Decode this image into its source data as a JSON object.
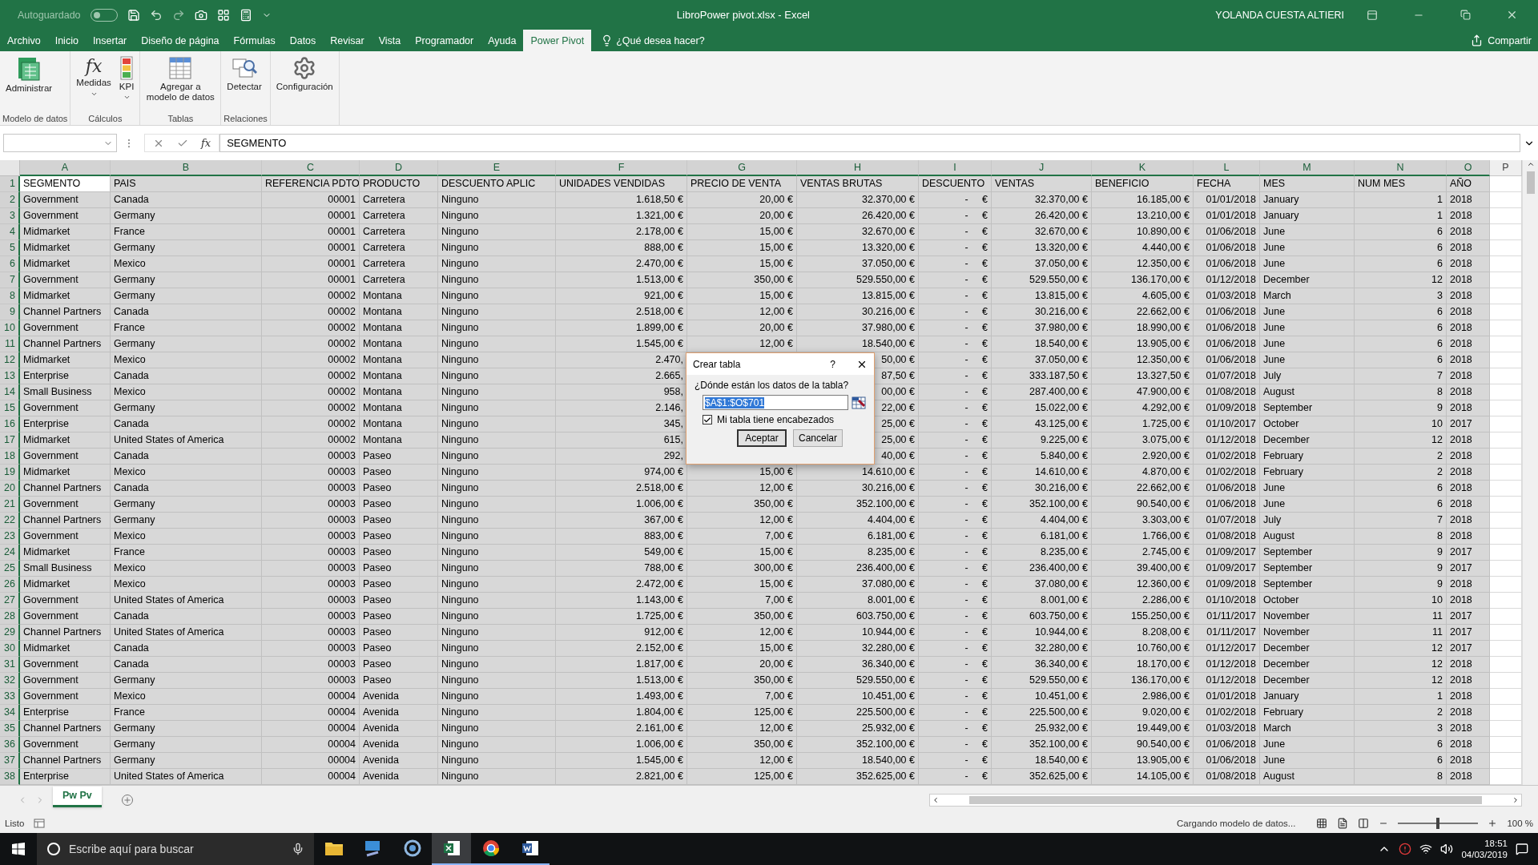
{
  "title_bar": {
    "autosave_label": "Autoguardado",
    "autosave_on": false,
    "title": "LibroPower pivot.xlsx  -  Excel",
    "user": "YOLANDA CUESTA ALTIERI"
  },
  "menu_tabs": [
    {
      "label": "Archivo",
      "selected": false
    },
    {
      "label": "Inicio",
      "selected": false
    },
    {
      "label": "Insertar",
      "selected": false
    },
    {
      "label": "Diseño de página",
      "selected": false
    },
    {
      "label": "Fórmulas",
      "selected": false
    },
    {
      "label": "Datos",
      "selected": false
    },
    {
      "label": "Revisar",
      "selected": false
    },
    {
      "label": "Vista",
      "selected": false
    },
    {
      "label": "Programador",
      "selected": false
    },
    {
      "label": "Ayuda",
      "selected": false
    },
    {
      "label": "Power Pivot",
      "selected": true
    }
  ],
  "tell_me": "¿Qué desea hacer?",
  "share": "Compartir",
  "ribbon_groups": [
    {
      "label": "Modelo de datos",
      "buttons": [
        {
          "label": "Administrar",
          "kind": "manage"
        }
      ]
    },
    {
      "label": "Cálculos",
      "buttons": [
        {
          "label": "Medidas",
          "kind": "function",
          "glyph": "fx",
          "dropdown": true
        },
        {
          "label": "KPI",
          "kind": "kpi",
          "dropdown": true
        }
      ]
    },
    {
      "label": "Tablas",
      "buttons": [
        {
          "label": "Agregar a modelo de datos",
          "kind": "table"
        }
      ]
    },
    {
      "label": "Relaciones",
      "buttons": [
        {
          "label": "Detectar",
          "kind": "detect"
        }
      ]
    },
    {
      "buttons": [
        {
          "label": "Configuración",
          "kind": "settings"
        }
      ]
    }
  ],
  "formula_bar": {
    "glyph": "fx",
    "value": "SEGMENTO"
  },
  "sheet": {
    "columns": [
      {
        "letter": "A",
        "selected": true,
        "kind": "text"
      },
      {
        "letter": "B",
        "selected": true,
        "kind": "text"
      },
      {
        "letter": "C",
        "selected": true,
        "kind": "number"
      },
      {
        "letter": "D",
        "selected": true,
        "kind": "text"
      },
      {
        "letter": "E",
        "selected": true,
        "kind": "text"
      },
      {
        "letter": "F",
        "selected": true,
        "kind": "number"
      },
      {
        "letter": "G",
        "selected": true,
        "kind": "number"
      },
      {
        "letter": "H",
        "selected": true,
        "kind": "number"
      },
      {
        "letter": "I",
        "selected": true,
        "kind": "accounting"
      },
      {
        "letter": "J",
        "selected": true,
        "kind": "number"
      },
      {
        "letter": "K",
        "selected": true,
        "kind": "number"
      },
      {
        "letter": "L",
        "selected": true,
        "kind": "number"
      },
      {
        "letter": "M",
        "selected": true,
        "kind": "text"
      },
      {
        "letter": "N",
        "selected": true,
        "kind": "number"
      },
      {
        "letter": "O",
        "selected": true,
        "kind": "text"
      },
      {
        "letter": "P",
        "selected": false,
        "kind": "text"
      }
    ],
    "rows": [
      {
        "number": "1",
        "selected": true,
        "kind": "header",
        "cells": [
          "SEGMENTO",
          "PAIS",
          "REFERENCIA PDTO",
          "PRODUCTO",
          "DESCUENTO APLIC",
          "UNIDADES VENDIDAS",
          "PRECIO DE VENTA",
          "VENTAS BRUTAS",
          "DESCUENTO",
          "VENTAS",
          "BENEFICIO",
          "FECHA",
          "MES",
          "NUM MES",
          "AÑO"
        ]
      },
      {
        "number": "2",
        "selected": true,
        "kind": "data",
        "cells": [
          "Government",
          "Canada",
          "00001",
          "Carretera",
          "Ninguno",
          "1.618,50 €",
          "20,00 €",
          "32.370,00 €",
          "- €",
          "32.370,00 €",
          "16.185,00 €",
          "01/01/2018",
          "January",
          "1",
          "2018"
        ]
      },
      {
        "number": "3",
        "selected": true,
        "kind": "data",
        "cells": [
          "Government",
          "Germany",
          "00001",
          "Carretera",
          "Ninguno",
          "1.321,00 €",
          "20,00 €",
          "26.420,00 €",
          "- €",
          "26.420,00 €",
          "13.210,00 €",
          "01/01/2018",
          "January",
          "1",
          "2018"
        ]
      },
      {
        "number": "4",
        "selected": true,
        "kind": "data",
        "cells": [
          "Midmarket",
          "France",
          "00001",
          "Carretera",
          "Ninguno",
          "2.178,00 €",
          "15,00 €",
          "32.670,00 €",
          "- €",
          "32.670,00 €",
          "10.890,00 €",
          "01/06/2018",
          "June",
          "6",
          "2018"
        ]
      },
      {
        "number": "5",
        "selected": true,
        "kind": "data",
        "cells": [
          "Midmarket",
          "Germany",
          "00001",
          "Carretera",
          "Ninguno",
          "888,00 €",
          "15,00 €",
          "13.320,00 €",
          "- €",
          "13.320,00 €",
          "4.440,00 €",
          "01/06/2018",
          "June",
          "6",
          "2018"
        ]
      },
      {
        "number": "6",
        "selected": true,
        "kind": "data",
        "cells": [
          "Midmarket",
          "Mexico",
          "00001",
          "Carretera",
          "Ninguno",
          "2.470,00 €",
          "15,00 €",
          "37.050,00 €",
          "- €",
          "37.050,00 €",
          "12.350,00 €",
          "01/06/2018",
          "June",
          "6",
          "2018"
        ]
      },
      {
        "number": "7",
        "selected": true,
        "kind": "data",
        "cells": [
          "Government",
          "Germany",
          "00001",
          "Carretera",
          "Ninguno",
          "1.513,00 €",
          "350,00 €",
          "529.550,00 €",
          "- €",
          "529.550,00 €",
          "136.170,00 €",
          "01/12/2018",
          "December",
          "12",
          "2018"
        ]
      },
      {
        "number": "8",
        "selected": true,
        "kind": "data",
        "cells": [
          "Midmarket",
          "Germany",
          "00002",
          "Montana",
          "Ninguno",
          "921,00 €",
          "15,00 €",
          "13.815,00 €",
          "- €",
          "13.815,00 €",
          "4.605,00 €",
          "01/03/2018",
          "March",
          "3",
          "2018"
        ]
      },
      {
        "number": "9",
        "selected": true,
        "kind": "data",
        "cells": [
          "Channel Partners",
          "Canada",
          "00002",
          "Montana",
          "Ninguno",
          "2.518,00 €",
          "12,00 €",
          "30.216,00 €",
          "- €",
          "30.216,00 €",
          "22.662,00 €",
          "01/06/2018",
          "June",
          "6",
          "2018"
        ]
      },
      {
        "number": "10",
        "selected": true,
        "kind": "data",
        "cells": [
          "Government",
          "France",
          "00002",
          "Montana",
          "Ninguno",
          "1.899,00 €",
          "20,00 €",
          "37.980,00 €",
          "- €",
          "37.980,00 €",
          "18.990,00 €",
          "01/06/2018",
          "June",
          "6",
          "2018"
        ]
      },
      {
        "number": "11",
        "selected": true,
        "kind": "data",
        "cells": [
          "Channel Partners",
          "Germany",
          "00002",
          "Montana",
          "Ninguno",
          "1.545,00 €",
          "12,00 €",
          "18.540,00 €",
          "- €",
          "18.540,00 €",
          "13.905,00 €",
          "01/06/2018",
          "June",
          "6",
          "2018"
        ]
      },
      {
        "number": "12",
        "selected": true,
        "kind": "data",
        "cells": [
          "Midmarket",
          "Mexico",
          "00002",
          "Montana",
          "Ninguno",
          "2.470,",
          null,
          "50,00 €",
          "- €",
          "37.050,00 €",
          "12.350,00 €",
          "01/06/2018",
          "June",
          "6",
          "2018"
        ]
      },
      {
        "number": "13",
        "selected": true,
        "kind": "data",
        "cells": [
          "Enterprise",
          "Canada",
          "00002",
          "Montana",
          "Ninguno",
          "2.665,",
          null,
          "87,50 €",
          "- €",
          "333.187,50 €",
          "13.327,50 €",
          "01/07/2018",
          "July",
          "7",
          "2018"
        ]
      },
      {
        "number": "14",
        "selected": true,
        "kind": "data",
        "cells": [
          "Small Business",
          "Mexico",
          "00002",
          "Montana",
          "Ninguno",
          "958,",
          null,
          "00,00 €",
          "- €",
          "287.400,00 €",
          "47.900,00 €",
          "01/08/2018",
          "August",
          "8",
          "2018"
        ]
      },
      {
        "number": "15",
        "selected": true,
        "kind": "data",
        "cells": [
          "Government",
          "Germany",
          "00002",
          "Montana",
          "Ninguno",
          "2.146,",
          null,
          "22,00 €",
          "- €",
          "15.022,00 €",
          "4.292,00 €",
          "01/09/2018",
          "September",
          "9",
          "2018"
        ]
      },
      {
        "number": "16",
        "selected": true,
        "kind": "data",
        "cells": [
          "Enterprise",
          "Canada",
          "00002",
          "Montana",
          "Ninguno",
          "345,",
          null,
          "25,00 €",
          "- €",
          "43.125,00 €",
          "1.725,00 €",
          "01/10/2017",
          "October",
          "10",
          "2017"
        ]
      },
      {
        "number": "17",
        "selected": true,
        "kind": "data",
        "cells": [
          "Midmarket",
          "United States of America",
          "00002",
          "Montana",
          "Ninguno",
          "615,",
          null,
          "25,00 €",
          "- €",
          "9.225,00 €",
          "3.075,00 €",
          "01/12/2018",
          "December",
          "12",
          "2018"
        ]
      },
      {
        "number": "18",
        "selected": true,
        "kind": "data",
        "cells": [
          "Government",
          "Canada",
          "00003",
          "Paseo",
          "Ninguno",
          "292,",
          null,
          "40,00 €",
          "- €",
          "5.840,00 €",
          "2.920,00 €",
          "01/02/2018",
          "February",
          "2",
          "2018"
        ]
      },
      {
        "number": "19",
        "selected": true,
        "kind": "data",
        "cells": [
          "Midmarket",
          "Mexico",
          "00003",
          "Paseo",
          "Ninguno",
          "974,00 €",
          "15,00 €",
          "14.610,00 €",
          "- €",
          "14.610,00 €",
          "4.870,00 €",
          "01/02/2018",
          "February",
          "2",
          "2018"
        ]
      },
      {
        "number": "20",
        "selected": true,
        "kind": "data",
        "cells": [
          "Channel Partners",
          "Canada",
          "00003",
          "Paseo",
          "Ninguno",
          "2.518,00 €",
          "12,00 €",
          "30.216,00 €",
          "- €",
          "30.216,00 €",
          "22.662,00 €",
          "01/06/2018",
          "June",
          "6",
          "2018"
        ]
      },
      {
        "number": "21",
        "selected": true,
        "kind": "data",
        "cells": [
          "Government",
          "Germany",
          "00003",
          "Paseo",
          "Ninguno",
          "1.006,00 €",
          "350,00 €",
          "352.100,00 €",
          "- €",
          "352.100,00 €",
          "90.540,00 €",
          "01/06/2018",
          "June",
          "6",
          "2018"
        ]
      },
      {
        "number": "22",
        "selected": true,
        "kind": "data",
        "cells": [
          "Channel Partners",
          "Germany",
          "00003",
          "Paseo",
          "Ninguno",
          "367,00 €",
          "12,00 €",
          "4.404,00 €",
          "- €",
          "4.404,00 €",
          "3.303,00 €",
          "01/07/2018",
          "July",
          "7",
          "2018"
        ]
      },
      {
        "number": "23",
        "selected": true,
        "kind": "data",
        "cells": [
          "Government",
          "Mexico",
          "00003",
          "Paseo",
          "Ninguno",
          "883,00 €",
          "7,00 €",
          "6.181,00 €",
          "- €",
          "6.181,00 €",
          "1.766,00 €",
          "01/08/2018",
          "August",
          "8",
          "2018"
        ]
      },
      {
        "number": "24",
        "selected": true,
        "kind": "data",
        "cells": [
          "Midmarket",
          "France",
          "00003",
          "Paseo",
          "Ninguno",
          "549,00 €",
          "15,00 €",
          "8.235,00 €",
          "- €",
          "8.235,00 €",
          "2.745,00 €",
          "01/09/2017",
          "September",
          "9",
          "2017"
        ]
      },
      {
        "number": "25",
        "selected": true,
        "kind": "data",
        "cells": [
          "Small Business",
          "Mexico",
          "00003",
          "Paseo",
          "Ninguno",
          "788,00 €",
          "300,00 €",
          "236.400,00 €",
          "- €",
          "236.400,00 €",
          "39.400,00 €",
          "01/09/2017",
          "September",
          "9",
          "2017"
        ]
      },
      {
        "number": "26",
        "selected": true,
        "kind": "data",
        "cells": [
          "Midmarket",
          "Mexico",
          "00003",
          "Paseo",
          "Ninguno",
          "2.472,00 €",
          "15,00 €",
          "37.080,00 €",
          "- €",
          "37.080,00 €",
          "12.360,00 €",
          "01/09/2018",
          "September",
          "9",
          "2018"
        ]
      },
      {
        "number": "27",
        "selected": true,
        "kind": "data",
        "cells": [
          "Government",
          "United States of America",
          "00003",
          "Paseo",
          "Ninguno",
          "1.143,00 €",
          "7,00 €",
          "8.001,00 €",
          "- €",
          "8.001,00 €",
          "2.286,00 €",
          "01/10/2018",
          "October",
          "10",
          "2018"
        ]
      },
      {
        "number": "28",
        "selected": true,
        "kind": "data",
        "cells": [
          "Government",
          "Canada",
          "00003",
          "Paseo",
          "Ninguno",
          "1.725,00 €",
          "350,00 €",
          "603.750,00 €",
          "- €",
          "603.750,00 €",
          "155.250,00 €",
          "01/11/2017",
          "November",
          "11",
          "2017"
        ]
      },
      {
        "number": "29",
        "selected": true,
        "kind": "data",
        "cells": [
          "Channel Partners",
          "United States of America",
          "00003",
          "Paseo",
          "Ninguno",
          "912,00 €",
          "12,00 €",
          "10.944,00 €",
          "- €",
          "10.944,00 €",
          "8.208,00 €",
          "01/11/2017",
          "November",
          "11",
          "2017"
        ]
      },
      {
        "number": "30",
        "selected": true,
        "kind": "data",
        "cells": [
          "Midmarket",
          "Canada",
          "00003",
          "Paseo",
          "Ninguno",
          "2.152,00 €",
          "15,00 €",
          "32.280,00 €",
          "- €",
          "32.280,00 €",
          "10.760,00 €",
          "01/12/2017",
          "December",
          "12",
          "2017"
        ]
      },
      {
        "number": "31",
        "selected": true,
        "kind": "data",
        "cells": [
          "Government",
          "Canada",
          "00003",
          "Paseo",
          "Ninguno",
          "1.817,00 €",
          "20,00 €",
          "36.340,00 €",
          "- €",
          "36.340,00 €",
          "18.170,00 €",
          "01/12/2018",
          "December",
          "12",
          "2018"
        ]
      },
      {
        "number": "32",
        "selected": true,
        "kind": "data",
        "cells": [
          "Government",
          "Germany",
          "00003",
          "Paseo",
          "Ninguno",
          "1.513,00 €",
          "350,00 €",
          "529.550,00 €",
          "- €",
          "529.550,00 €",
          "136.170,00 €",
          "01/12/2018",
          "December",
          "12",
          "2018"
        ]
      },
      {
        "number": "33",
        "selected": true,
        "kind": "data",
        "cells": [
          "Government",
          "Mexico",
          "00004",
          "Avenida",
          "Ninguno",
          "1.493,00 €",
          "7,00 €",
          "10.451,00 €",
          "- €",
          "10.451,00 €",
          "2.986,00 €",
          "01/01/2018",
          "January",
          "1",
          "2018"
        ]
      },
      {
        "number": "34",
        "selected": true,
        "kind": "data",
        "cells": [
          "Enterprise",
          "France",
          "00004",
          "Avenida",
          "Ninguno",
          "1.804,00 €",
          "125,00 €",
          "225.500,00 €",
          "- €",
          "225.500,00 €",
          "9.020,00 €",
          "01/02/2018",
          "February",
          "2",
          "2018"
        ]
      },
      {
        "number": "35",
        "selected": true,
        "kind": "data",
        "cells": [
          "Channel Partners",
          "Germany",
          "00004",
          "Avenida",
          "Ninguno",
          "2.161,00 €",
          "12,00 €",
          "25.932,00 €",
          "- €",
          "25.932,00 €",
          "19.449,00 €",
          "01/03/2018",
          "March",
          "3",
          "2018"
        ]
      },
      {
        "number": "36",
        "selected": true,
        "kind": "data",
        "cells": [
          "Government",
          "Germany",
          "00004",
          "Avenida",
          "Ninguno",
          "1.006,00 €",
          "350,00 €",
          "352.100,00 €",
          "- €",
          "352.100,00 €",
          "90.540,00 €",
          "01/06/2018",
          "June",
          "6",
          "2018"
        ]
      },
      {
        "number": "37",
        "selected": true,
        "kind": "data",
        "cells": [
          "Channel Partners",
          "Germany",
          "00004",
          "Avenida",
          "Ninguno",
          "1.545,00 €",
          "12,00 €",
          "18.540,00 €",
          "- €",
          "18.540,00 €",
          "13.905,00 €",
          "01/06/2018",
          "June",
          "6",
          "2018"
        ]
      },
      {
        "number": "38",
        "selected": true,
        "kind": "data",
        "cells": [
          "Enterprise",
          "United States of America",
          "00004",
          "Avenida",
          "Ninguno",
          "2.821,00 €",
          "125,00 €",
          "352.625,00 €",
          "- €",
          "352.625,00 €",
          "14.105,00 €",
          "01/08/2018",
          "August",
          "8",
          "2018"
        ]
      }
    ]
  },
  "dialog": {
    "title": "Crear tabla",
    "help": "?",
    "prompt": "¿Dónde están los datos de la tabla?",
    "range": "$A$1:$O$701",
    "headers_label": "Mi tabla tiene encabezados",
    "headers_checked": true,
    "buttons": [
      {
        "label": "Aceptar",
        "default": true
      },
      {
        "label": "Cancelar",
        "default": false
      }
    ]
  },
  "sheet_tabs": [
    {
      "label": "Pw Pv",
      "selected": true
    }
  ],
  "status_bar": {
    "status": "Listo",
    "message": "Cargando modelo de datos...",
    "zoom_slider": {
      "level": 0.5
    },
    "zoom": "100 %"
  },
  "taskbar": {
    "search_placeholder": "Escribe aquí para buscar",
    "apps": [
      {
        "kind": "files",
        "running": false
      },
      {
        "kind": "remote",
        "running": false
      },
      {
        "kind": "circle",
        "running": false
      },
      {
        "kind": "excel",
        "running": true
      },
      {
        "kind": "chrome",
        "running": true
      },
      {
        "kind": "word",
        "running": true
      }
    ],
    "time": "18:51",
    "date": "04/03/2019"
  }
}
